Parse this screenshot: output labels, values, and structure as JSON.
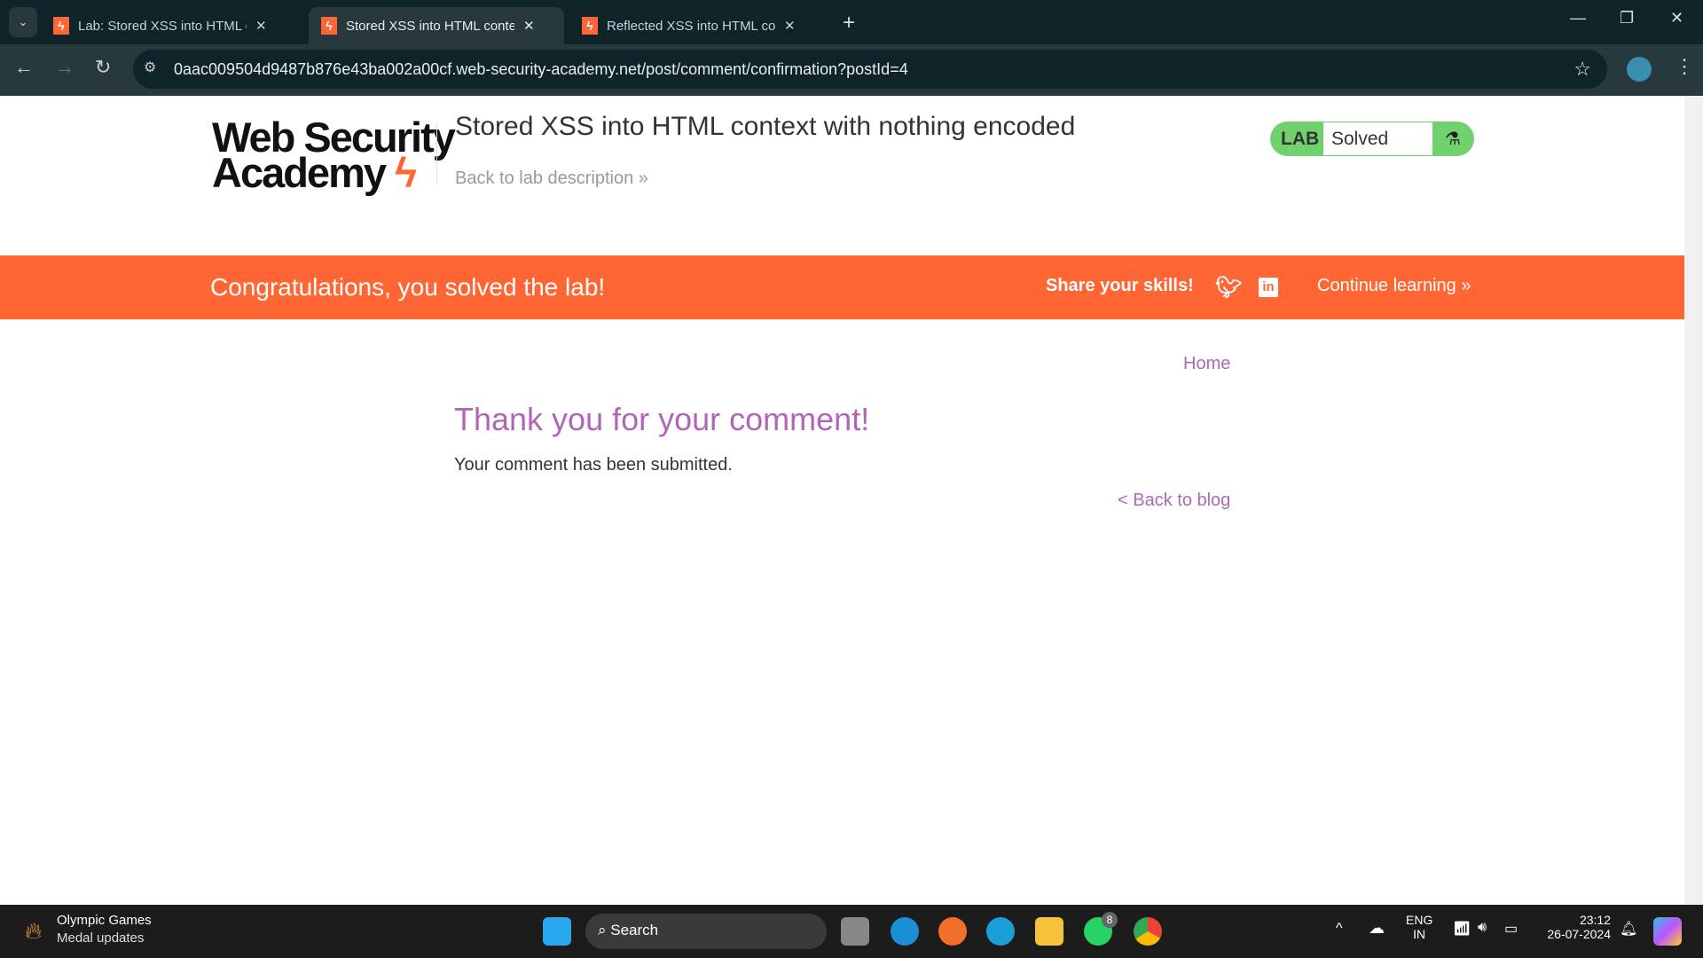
{
  "browser": {
    "tabs": [
      {
        "title": "Lab: Stored XSS into HTML cont"
      },
      {
        "title": "Stored XSS into HTML context w"
      },
      {
        "title": "Reflected XSS into HTML contex"
      }
    ],
    "url": "0aac009504d9487b876e43ba002a00cf.web-security-academy.net/post/comment/confirmation?postId=4"
  },
  "header": {
    "logo": "Web Security Academy",
    "lab_title": "Stored XSS into HTML context with nothing encoded",
    "back_link": "Back to lab description",
    "badge_label": "LAB",
    "badge_status": "Solved"
  },
  "banner": {
    "message": "Congratulations, you solved the lab!",
    "share": "Share your skills!",
    "continue": "Continue learning"
  },
  "content": {
    "home": "Home",
    "heading": "Thank you for your comment!",
    "message": "Your comment has been submitted.",
    "back": "< Back to blog"
  },
  "taskbar": {
    "news_title": "Olympic Games",
    "news_sub": "Medal updates",
    "search": "Search",
    "whatsapp_badge": "8",
    "lang": "ENG",
    "region": "IN",
    "time": "23:12",
    "date": "26-07-2024"
  },
  "colors": {
    "accent": "#ff6633",
    "link": "#b065b7",
    "lab_green": "#70d16d"
  }
}
